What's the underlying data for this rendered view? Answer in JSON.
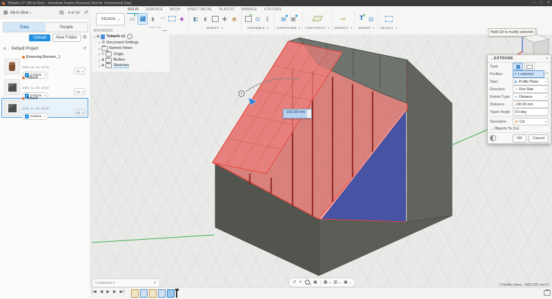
{
  "window": {
    "title": "Toltarki v1* (All-in-One) - Autodesk Fusion Personal (Not for Commercial Use)"
  },
  "app_bar": {
    "workspace": "All-in One",
    "pager": "4 of 10"
  },
  "document_tab": "Toltarki v1*",
  "data_panel": {
    "tabs": [
      {
        "label": "Data"
      },
      {
        "label": "People"
      }
    ],
    "upload": "Upload",
    "new_folder": "New Folder",
    "project": "Default Project",
    "items": [
      {
        "name": "Browning Booster_1",
        "date": "2025. 02. 16. 21:04",
        "status": "Editable",
        "version": "V1"
      },
      {
        "name": "Toltarki",
        "date": "2025. 12. 29. 19:22",
        "status": "Editable",
        "version": "V1"
      },
      {
        "name": "Toltarki",
        "date": "2025. 12. 29. 18:55",
        "status": "Editable",
        "version": "V1"
      }
    ]
  },
  "ribbon": {
    "design": "DESIGN",
    "tabs": [
      "SOLID",
      "SURFACE",
      "MESH",
      "SHEET METAL",
      "PLASTIC",
      "MANAGE",
      "UTILITIES"
    ],
    "groups": [
      "CREATE",
      "MODIFY",
      "ASSEMBLE",
      "CONFIGURE",
      "CONSTRUCT",
      "INSPECT",
      "INSERT",
      "SELECT"
    ]
  },
  "browser": {
    "header": "BROWSER",
    "root": "Toltarki v1",
    "nodes": [
      "Document Settings",
      "Named Views",
      "Origin",
      "Bodies",
      "Sketches"
    ]
  },
  "viewport": {
    "tooltip": "Hold Ctrl to modify selection",
    "floating_value": "-150.00 mm",
    "comments": "COMMENTS",
    "selection_status": "1 Profile | Area - 4921.001 mm^2"
  },
  "extrude": {
    "title": "EXTRUDE",
    "type_label": "Type",
    "profiles_label": "Profiles",
    "profiles_value": "1 selected",
    "start_label": "Start",
    "start_value": "Profile Plane",
    "direction_label": "Direction",
    "direction_value": "One Side",
    "extent_label": "Extent Type",
    "extent_value": "Distance",
    "distance_label": "Distance",
    "distance_value": "-150.00 mm",
    "taper_label": "Taper Angle",
    "taper_value": "0.0 deg",
    "operation_label": "Operation",
    "operation_value": "Cut",
    "objects_to_cut": "Objects To Cut",
    "ok": "OK",
    "cancel": "Cancel"
  },
  "colors": {
    "accent_blue": "#0696d7",
    "selection_red": "#d8453c",
    "profile_blue": "#3d4a9e",
    "axis_green": "#3fae4a"
  }
}
